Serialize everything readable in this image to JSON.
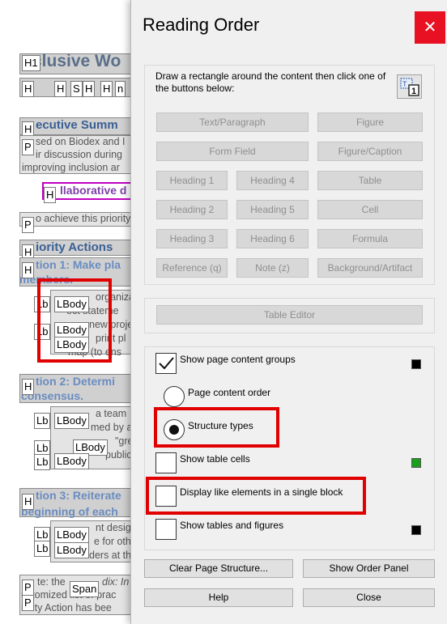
{
  "document": {
    "headings": {
      "title": "clusive Wo",
      "exec_summary": "ecutive Summ",
      "collab": "llaborative d",
      "priority_actions": "iority Actions",
      "action1": "tion 1: Make pla",
      "action1_cont": "members.",
      "action2": "tion 2: Determi",
      "action2_cont": "consensus.",
      "action3": "tion 3: Reiterate",
      "action3_cont": "beginning of each"
    },
    "body_lines": [
      "sed on Biodex and I",
      "ir discussion during",
      "improving inclusion ar",
      "o achieve this priority,",
      "organizat",
      "ect stateme",
      "new proje",
      "print pl",
      "map (to ens",
      "a team",
      "med by a",
      "\"gre",
      "public",
      "nt desig",
      "e for oth",
      "ders at the",
      "te: the",
      "dix: In",
      "ustomized list of prac",
      "iority Action has bee"
    ],
    "tags": {
      "h1": "H1",
      "h": "H",
      "p": "P",
      "lb": "Lb",
      "lbody": "LBody",
      "span": "Span",
      "s": "S",
      "n": "n"
    }
  },
  "dialog": {
    "title": "Reading Order",
    "close_glyph": "✕",
    "instructions": "Draw a rectangle around the content then click one of the buttons below:",
    "tag_buttons": [
      "Text/Paragraph",
      "Figure",
      "Form Field",
      "Figure/Caption",
      "Heading 1",
      "Heading 4",
      "Table",
      "Heading 2",
      "Heading 5",
      "Cell",
      "Heading 3",
      "Heading 6",
      "Formula",
      "Reference (q)",
      "Note (z)",
      "Background/Artifact"
    ],
    "table_editor": "Table Editor",
    "options": {
      "show_page_content_groups": "Show page content groups",
      "page_content_order": "Page content order",
      "structure_types": "Structure types",
      "show_table_cells": "Show table cells",
      "display_like_elements": "Display like elements in a single block",
      "show_tables_and_figures": "Show tables and figures"
    },
    "state": {
      "show_page_content_groups": true,
      "view_mode": "structure_types",
      "show_table_cells": false,
      "display_like_elements": false,
      "show_tables_and_figures": false
    },
    "swatch_colors": {
      "content_groups": "#000000",
      "table_cells": "#1aa01a",
      "tables_figures": "#000000"
    },
    "bottom_buttons": {
      "clear_structure": "Clear Page Structure...",
      "show_order_panel": "Show Order Panel",
      "help": "Help",
      "close": "Close"
    }
  }
}
